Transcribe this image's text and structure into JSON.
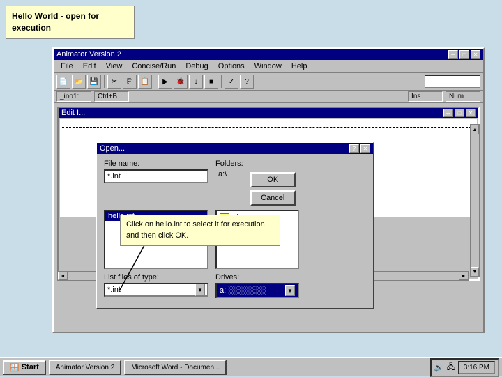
{
  "tooltip": {
    "text": "Hello World - open for execution"
  },
  "main_window": {
    "title": "Animator Version 2",
    "controls": [
      "─",
      "□",
      "✕"
    ]
  },
  "menubar": {
    "items": [
      "File",
      "Edit",
      "View",
      "Concise/Run",
      "Debug",
      "Options",
      "Window",
      "Help"
    ]
  },
  "toolbar": {
    "shortcut_label": "_ino1:",
    "shortcut_value": "Ctrl+B"
  },
  "status": {
    "ins_label": "Ins",
    "num_label": "Num"
  },
  "edit_window": {
    "title": "Edit I..."
  },
  "open_dialog": {
    "title": "Open...",
    "help_btn": "?",
    "close_btn": "✕",
    "file_name_label": "File name:",
    "file_name_value": "*.int",
    "folders_label": "Folders:",
    "folders_value": "a:\\",
    "ok_btn": "OK",
    "cancel_btn": "Cancel",
    "list_files_label": "List files of type:",
    "list_files_value": "*.int",
    "drives_label": "Drives:",
    "drives_value": "a: ■■■■■■■■■■",
    "file_list": [
      "hello.int"
    ],
    "folder_list": [
      "a:\\"
    ]
  },
  "annotation": {
    "text": "Click on hello.int to select it for execution and then click OK."
  },
  "taskbar": {
    "start_label": "Start",
    "btn1": "Animator Version 2",
    "btn2": "Microsoft Word - Documen...",
    "time": "3:16 PM"
  }
}
